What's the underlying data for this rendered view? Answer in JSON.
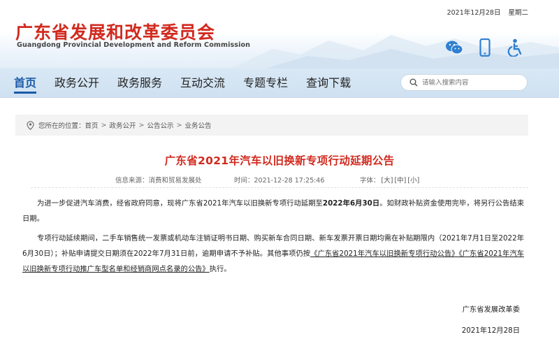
{
  "header": {
    "date": "2021年12月28日",
    "weekday": "星期二",
    "logo_cn": "广东省发展和改革委员会",
    "logo_en": "Guangdong Provincial Development and Reform Commission",
    "icons": [
      "wechat-icon",
      "mobile-icon",
      "accessibility-icon"
    ],
    "brand_red": "#d12a1f",
    "brand_blue": "#1a5aa8"
  },
  "nav": {
    "items": [
      {
        "label": "首页",
        "active": true
      },
      {
        "label": "政务公开"
      },
      {
        "label": "政务服务"
      },
      {
        "label": "互动交流"
      },
      {
        "label": "专题专栏"
      },
      {
        "label": "查询下载"
      }
    ],
    "search_placeholder": "请输入搜索内容",
    "search_icon": "search-icon"
  },
  "breadcrumb": {
    "prefix": "您所在的位置：",
    "items": [
      "首页",
      "政务公开",
      "公告公示",
      "业务公告"
    ],
    "separator": ">"
  },
  "article": {
    "title": "广东省2021年汽车以旧换新专项行动延期公告",
    "source": "信息来源：消费和贸易发展处",
    "time": "时间：2021-12-28 17:25:46",
    "font_label": "字体：",
    "font_sizes": [
      "[大]",
      "[中]",
      "[小]"
    ],
    "p1_a": "为进一步促进汽车消费，经省政府同意，现将广东省2021年汽车以旧换新专项行动延期至",
    "p1_bold": "2022年6月30日",
    "p1_b": "。如财政补贴资金使用完毕，将另行公告结束日期。",
    "p2_a": "专项行动延续期间，二手车销售统一发票或机动车注销证明书日期、购买新车合同日期、新车发票开票日期均需在补贴期限内（2021年7月1日至2022年6月30日）；补贴申请提交日期须在2022年7月31日前，逾期申请不予补贴。其他事项仍按",
    "p2_link1": "《广东省2021年汽车以旧换新专项行动公告》",
    "p2_link2": "《广东省2021年汽车以旧换新专项行动推广车型名单和经销商网点名录的公告》",
    "p2_b": "执行。",
    "signature": "广东省发展改革委",
    "sign_date": "2021年12月28日"
  }
}
